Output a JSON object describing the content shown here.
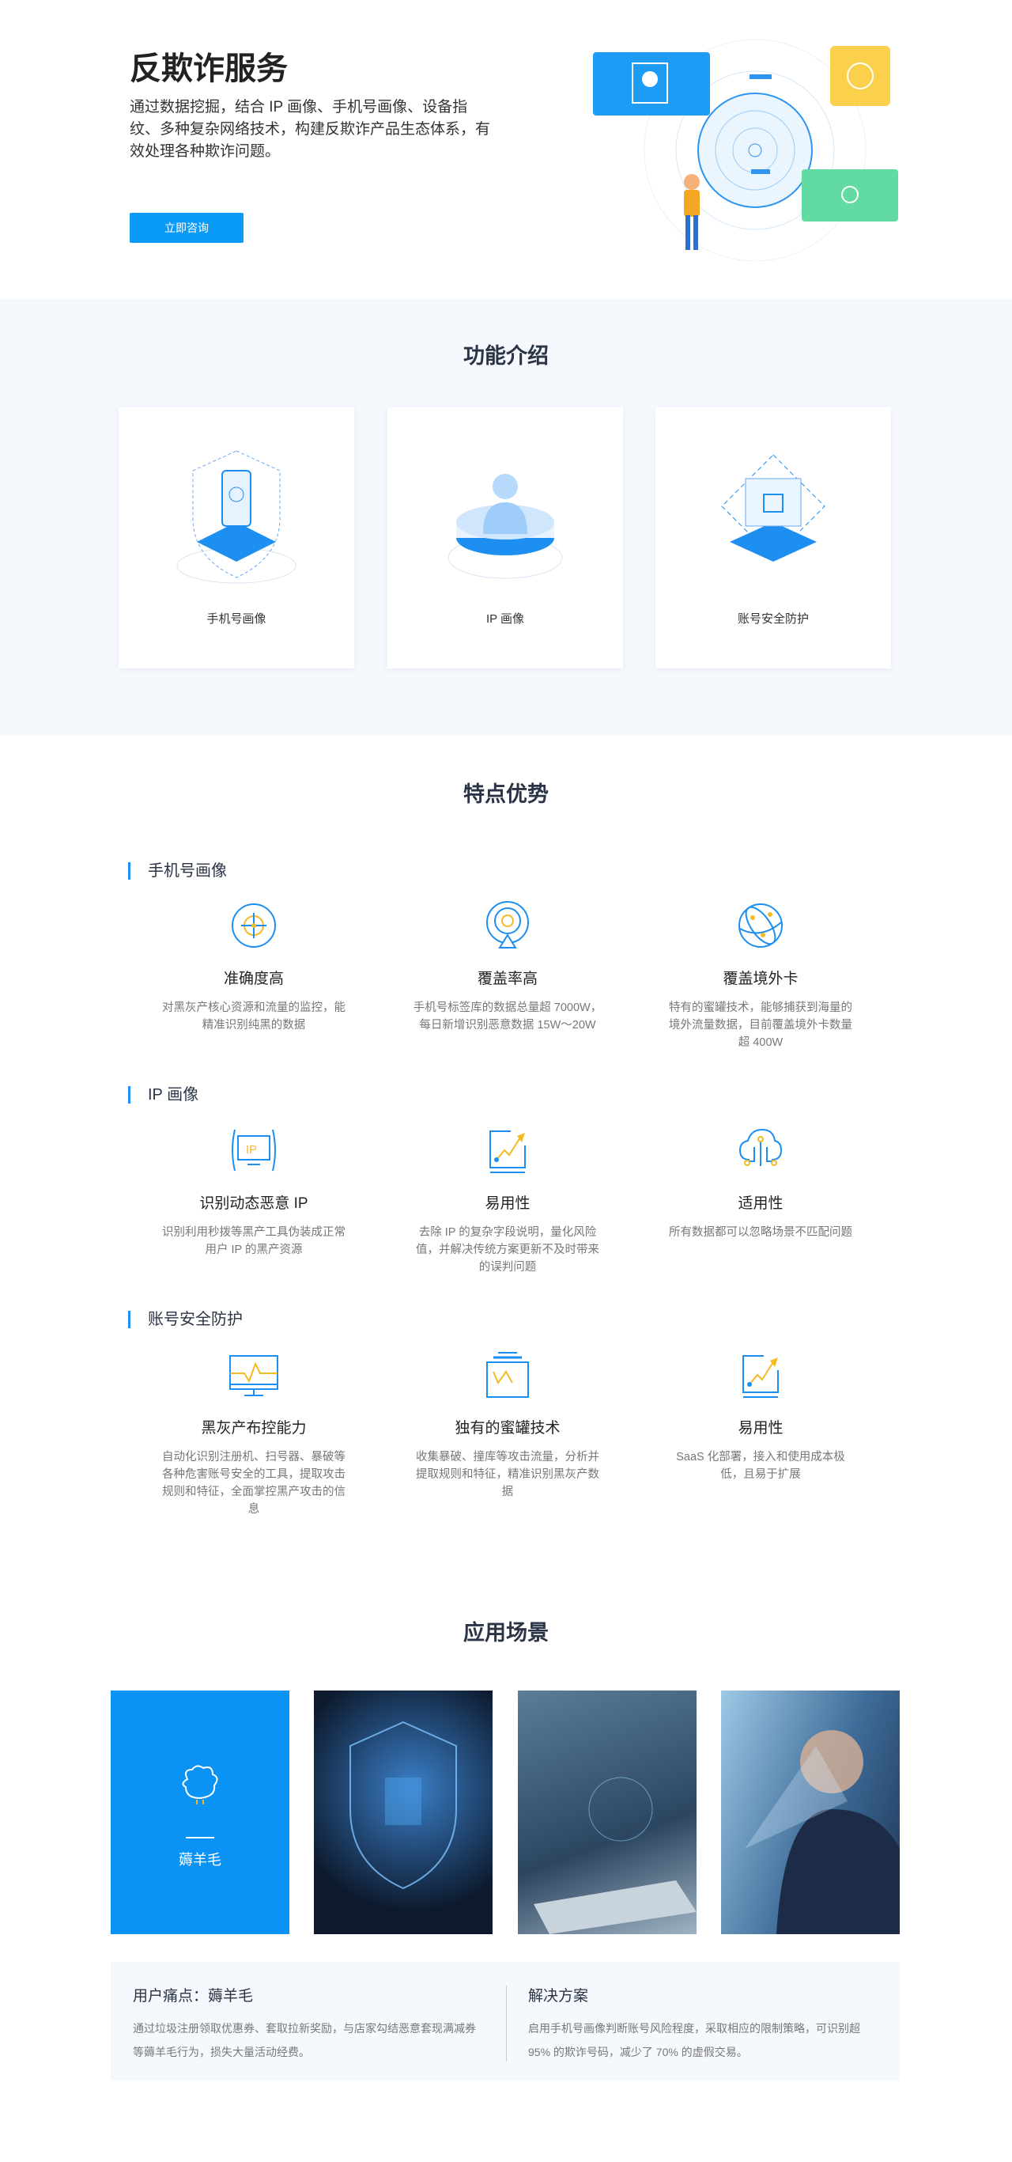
{
  "hero": {
    "title": "反欺诈服务",
    "description": "通过数据挖掘，结合 IP 画像、手机号画像、设备指纹、多种复杂网络技术，构建反欺诈产品生态体系，有效处理各种欺诈问题。",
    "button": "立即咨询",
    "accent": "#0a9bf7"
  },
  "functions": {
    "title": "功能介绍",
    "cards": [
      {
        "label": "手机号画像",
        "icon": "phone-shield-icon"
      },
      {
        "label": "IP 画像",
        "icon": "ip-user-icon"
      },
      {
        "label": "账号安全防护",
        "icon": "account-security-icon"
      }
    ]
  },
  "advantages": {
    "title": "特点优势",
    "groups": [
      {
        "title": "手机号画像",
        "items": [
          {
            "icon": "target-icon",
            "title": "准确度高",
            "desc": "对黑灰产核心资源和流量的监控，能精准识别纯黑的数据"
          },
          {
            "icon": "radar-icon",
            "title": "覆盖率高",
            "desc": "手机号标签库的数据总量超 7000W，每日新增识别恶意数据 15W～20W"
          },
          {
            "icon": "globe-icon",
            "title": "覆盖境外卡",
            "desc": "特有的蜜罐技术，能够捕获到海量的境外流量数据，目前覆盖境外卡数量超 400W"
          }
        ]
      },
      {
        "title": "IP 画像",
        "items": [
          {
            "icon": "ip-monitor-icon",
            "title": "识别动态恶意 IP",
            "desc": "识别利用秒拨等黑产工具伪装成正常用户 IP 的黑产资源"
          },
          {
            "icon": "trend-chart-icon",
            "title": "易用性",
            "desc": "去除 IP 的复杂字段说明，量化风险值，并解决传统方案更新不及时带来的误判问题"
          },
          {
            "icon": "cloud-network-icon",
            "title": "适用性",
            "desc": "所有数据都可以忽略场景不匹配问题"
          }
        ]
      },
      {
        "title": "账号安全防护",
        "items": [
          {
            "icon": "monitor-pulse-icon",
            "title": "黑灰产布控能力",
            "desc": "自动化识别注册机、扫号器、暴破等各种危害账号安全的工具，提取攻击规则和特征，全面掌控黑产攻击的信息"
          },
          {
            "icon": "honeypot-icon",
            "title": "独有的蜜罐技术",
            "desc": "收集暴破、撞库等攻击流量，分析并提取规则和特征，精准识别黑灰产数据"
          },
          {
            "icon": "trend-chart-icon",
            "title": "易用性",
            "desc": "SaaS 化部署，接入和使用成本极低，且易于扩展"
          }
        ]
      }
    ]
  },
  "scenes": {
    "title": "应用场景",
    "active_label": "薅羊毛",
    "cards": [
      "sheep-icon",
      "security-shield-image",
      "laptop-image",
      "face-recognition-image"
    ],
    "pain_title": "用户痛点：薅羊毛",
    "pain_desc": "通过垃圾注册领取优惠券、套取拉新奖励，与店家勾结恶意套现满减券等薅羊毛行为，损失大量活动经费。",
    "solution_title": "解决方案",
    "solution_desc": "启用手机号画像判断账号风险程度，采取相应的限制策略，可识别超 95% 的欺诈号码，减少了 70% 的虚假交易。"
  }
}
